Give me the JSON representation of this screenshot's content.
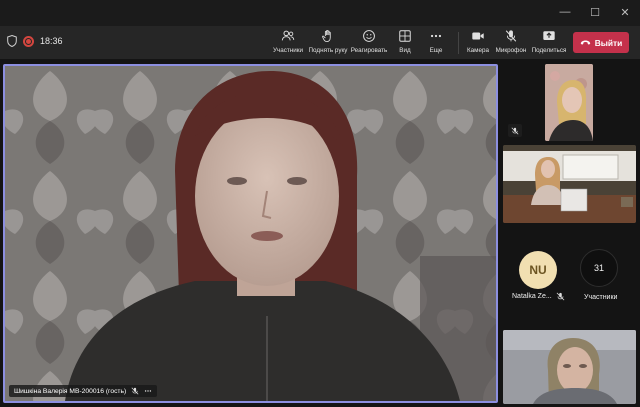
{
  "toolbar": {
    "timer": "18:36",
    "buttons": {
      "participants": "Участники",
      "raise_hand": "Поднять руку",
      "react": "Реагировать",
      "view": "Вид",
      "more": "Еще",
      "camera": "Камера",
      "mic": "Микрофон",
      "share": "Поделиться"
    },
    "leave_label": "Выйти"
  },
  "main_video": {
    "participant_name": "Шишкіна Валерія МВ-200016 (гость)"
  },
  "side_panel": {
    "avatar_initials": "NU",
    "avatar_name": "Natalka Ze...",
    "participants_count": "31",
    "participants_label": "Участники"
  },
  "colors": {
    "leave": "#c4314b",
    "active_border": "#8c8fe0",
    "avatar_bg": "#f1dfb1",
    "recording": "#d4463f"
  }
}
